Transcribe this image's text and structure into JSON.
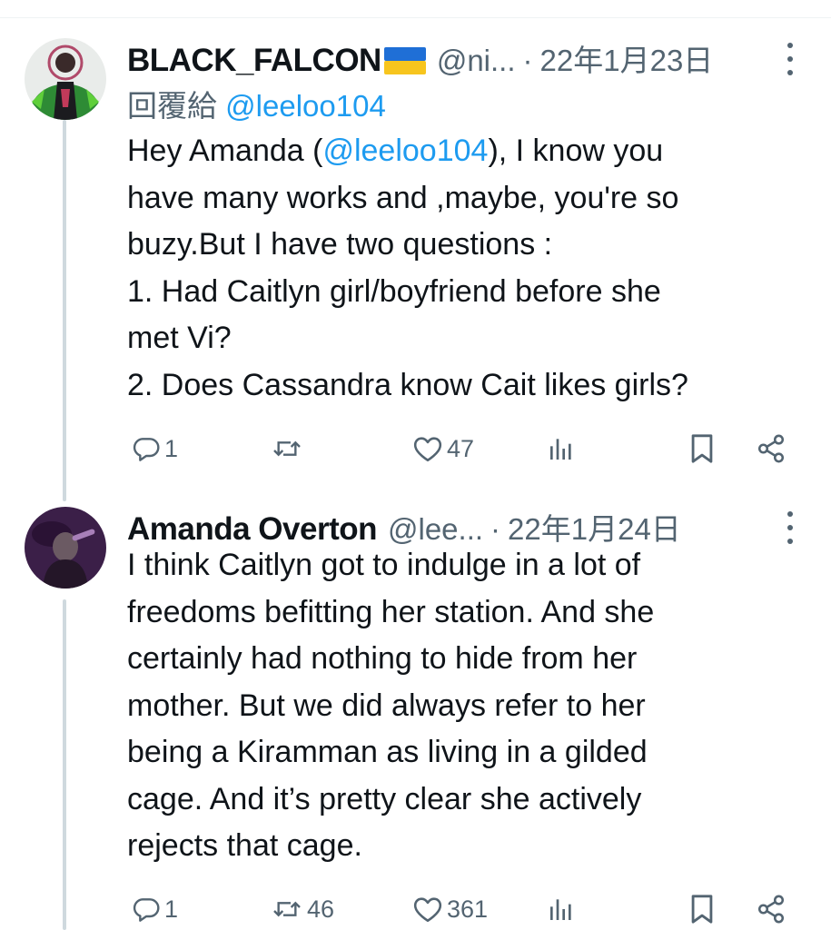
{
  "colors": {
    "text": "#0f1419",
    "secondary": "#536471",
    "link": "#1d9bf0",
    "thread_line": "#cfd9de"
  },
  "tweets": [
    {
      "display_name": "BLACK_FALCON",
      "name_flag": "ukraine-flag-emoji",
      "handle": "@ni...",
      "separator": "·",
      "date": "22年1月23日",
      "replying_prefix": "回覆給",
      "replying_to": "@leeloo104",
      "text_lines": [
        {
          "before": "Hey Amanda (",
          "mention": "@leeloo104",
          "after": "), I know you"
        },
        {
          "text": "have many works and ,maybe, you're  so"
        },
        {
          "text": "buzy.But I have two questions :"
        },
        {
          "text": "1. Had Caitlyn girl/boyfriend before she"
        },
        {
          "text": "met Vi?"
        },
        {
          "text": "2. Does Cassandra know Cait likes girls?"
        }
      ],
      "actions": {
        "reply_count": "1",
        "retweet_count": "",
        "like_count": "47",
        "views_icon": "analytics-icon",
        "bookmark_icon": "bookmark-icon",
        "share_icon": "share-icon"
      }
    },
    {
      "display_name": "Amanda Overton",
      "handle": "@lee...",
      "separator": "·",
      "date": "22年1月24日",
      "text_lines": [
        {
          "text": "I think Caitlyn got to indulge in a lot of"
        },
        {
          "text": "freedoms befitting her station. And she"
        },
        {
          "text": "certainly had nothing to hide from her"
        },
        {
          "text": "mother. But we did always refer to her"
        },
        {
          "text": "being a Kiramman as living in a gilded"
        },
        {
          "text": "cage. And it’s pretty clear she actively"
        },
        {
          "text": "rejects that cage."
        }
      ],
      "actions": {
        "reply_count": "1",
        "retweet_count": "46",
        "like_count": "361",
        "views_icon": "analytics-icon",
        "bookmark_icon": "bookmark-icon",
        "share_icon": "share-icon"
      }
    }
  ]
}
